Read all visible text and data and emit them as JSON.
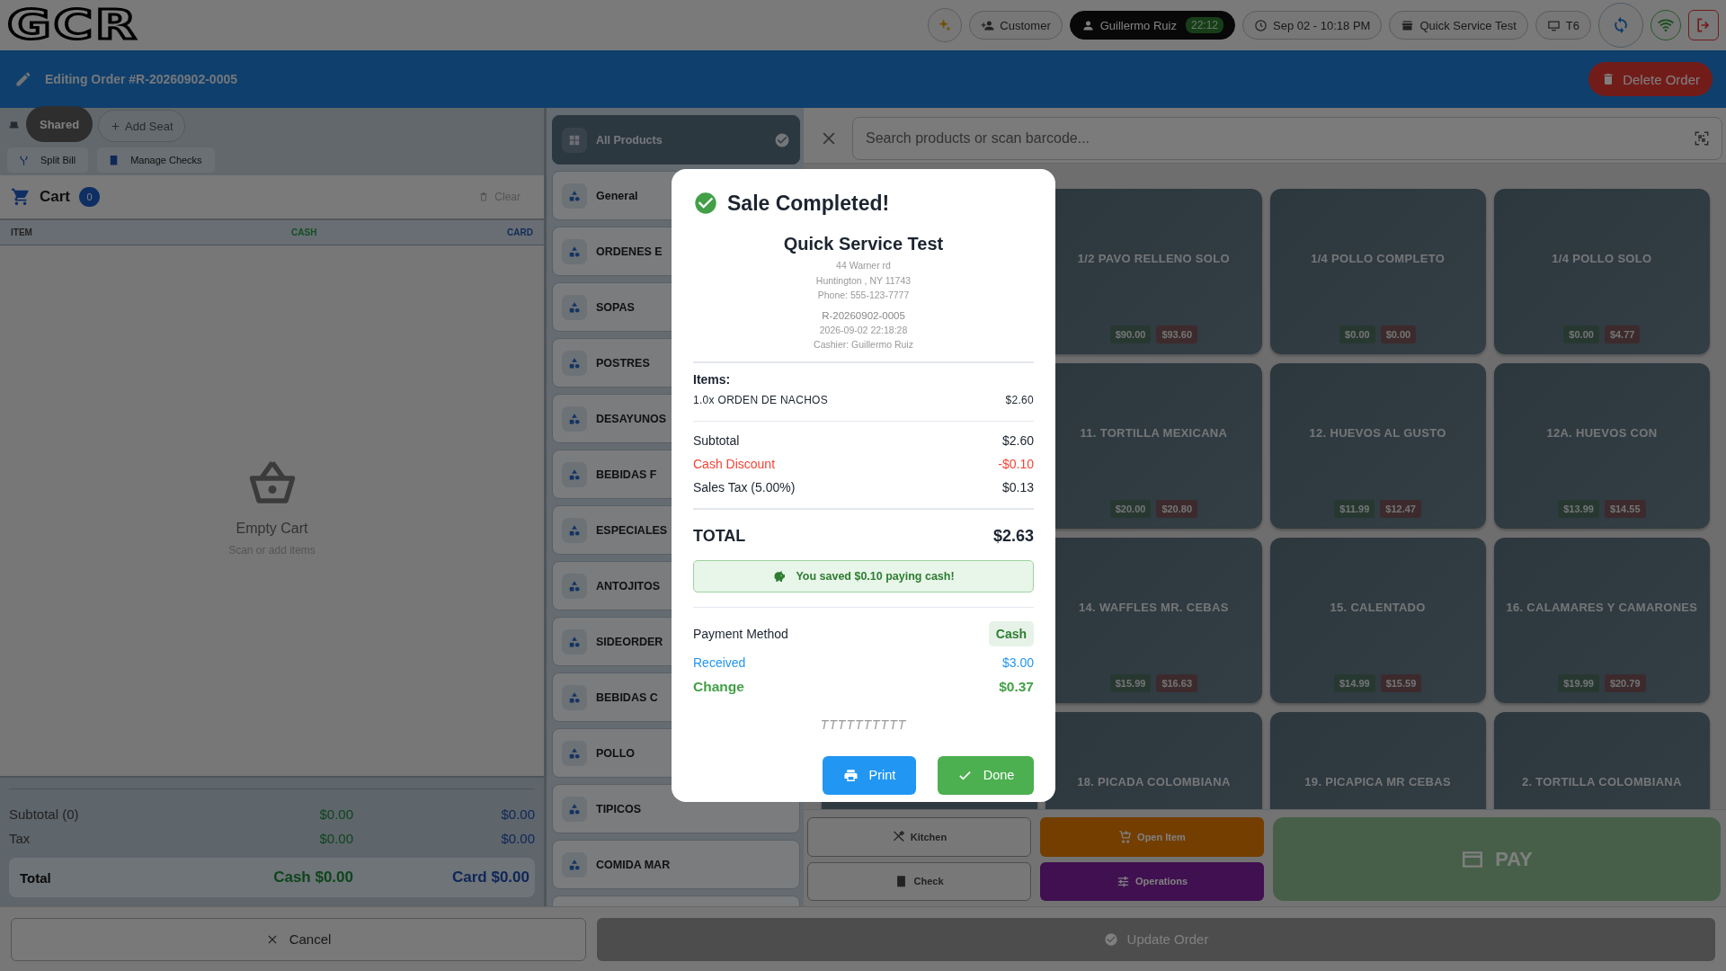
{
  "logo": "GCR",
  "top_bar": {
    "customer_button": "Customer",
    "user": {
      "name": "Guillermo Ruiz",
      "time": "22:12"
    },
    "datetime": "Sep 02 - 10:18 PM",
    "store": "Quick Service Test",
    "terminal": "T6"
  },
  "order_header": {
    "title": "Editing Order #R-20260902-0005",
    "delete_button": "Delete Order"
  },
  "seats": [
    {
      "label": "Shared",
      "selected": true
    }
  ],
  "add_seat": "Add Seat",
  "check_actions": [
    {
      "label": "Split Bill",
      "kind": "split"
    },
    {
      "label": "Manage Checks",
      "kind": "checks"
    }
  ],
  "cart": {
    "title": "Cart",
    "count": "0",
    "clear": "Clear",
    "columns": [
      "ITEM",
      "CASH",
      "CARD"
    ],
    "empty_title": "Empty Cart",
    "empty_hint": "Scan or add items"
  },
  "totals": {
    "rows": [
      {
        "label": "Subtotal (0)",
        "cash": "$0.00",
        "card": "$0.00"
      },
      {
        "label": "Tax",
        "cash": "$0.00",
        "card": "$0.00"
      }
    ],
    "total": {
      "label": "Total",
      "cash": "Cash $0.00",
      "card": "Card $0.00"
    }
  },
  "categories": [
    {
      "label": "All Products",
      "selected": true
    },
    {
      "label": "General",
      "selected": false
    },
    {
      "label": "ORDENES E",
      "selected": false
    },
    {
      "label": "SOPAS",
      "selected": false
    },
    {
      "label": "POSTRES",
      "selected": false
    },
    {
      "label": "DESAYUNOS",
      "selected": false
    },
    {
      "label": "BEBIDAS F",
      "selected": false
    },
    {
      "label": "ESPECIALES",
      "selected": false
    },
    {
      "label": "ANTOJITOS",
      "selected": false
    },
    {
      "label": "SIDEORDER",
      "selected": false
    },
    {
      "label": "BEBIDAS C",
      "selected": false
    },
    {
      "label": "POLLO",
      "selected": false
    },
    {
      "label": "TIPICOS",
      "selected": false
    },
    {
      "label": "COMIDA MAR",
      "selected": false
    }
  ],
  "search": {
    "placeholder": "Search products or scan barcode..."
  },
  "products": [
    {
      "name": "1/2 PAVO RELLENO SOLO",
      "cash": "$90.00",
      "card": "$93.60"
    },
    {
      "name": "1/4 POLLO COMPLETO",
      "cash": "$0.00",
      "card": "$0.00"
    },
    {
      "name": "1/4 POLLO SOLO",
      "cash": "$0.00",
      "card": "$4.77"
    },
    {
      "name": "11. TORTILLA MEXICANA",
      "cash": "$20.00",
      "card": "$20.80"
    },
    {
      "name": "12. HUEVOS AL GUSTO",
      "cash": "$11.99",
      "card": "$12.47"
    },
    {
      "name": "12A. HUEVOS CON",
      "cash": "$13.99",
      "card": "$14.55"
    },
    {
      "name": "14. WAFFLES  MR. CEBAS",
      "cash": "$15.99",
      "card": "$16.63"
    },
    {
      "name": "15. CALENTADO",
      "cash": "$14.99",
      "card": "$15.59"
    },
    {
      "name": "16. CALAMARES Y CAMARONES",
      "cash": "$19.99",
      "card": "$20.79"
    },
    {
      "name": "18. PICADA COLOMBIANA"
    },
    {
      "name": "19. PICAPICA MR CEBAS"
    },
    {
      "name": "2. TORTILLA COLOMBIANA"
    }
  ],
  "actions": [
    {
      "label": "Kitchen",
      "kind": "kitchen"
    },
    {
      "label": "Open Item",
      "kind": "open"
    },
    {
      "label": "Check",
      "kind": "check"
    },
    {
      "label": "Operations",
      "kind": "operations"
    }
  ],
  "pay_button": {
    "label": "PAY",
    "disabled": true
  },
  "bottom_bar": {
    "cancel": "Cancel",
    "update": {
      "label": "Update Order",
      "disabled": true
    }
  },
  "modal": {
    "title": "Sale Completed!",
    "store_name": "Quick Service Test",
    "address": [
      "44 Warner rd",
      "Huntington , NY 11743",
      "Phone: 555-123-7777"
    ],
    "receipt_number": "R-20260902-0005",
    "receipt_datetime": "2026-09-02 22:18:28",
    "cashier": "Cashier: Guillermo Ruiz",
    "items_label": "Items:",
    "items": [
      {
        "text": "1.0x ORDEN DE NACHOS",
        "price": "$2.60"
      }
    ],
    "lines": [
      {
        "label": "Subtotal",
        "value": "$2.60",
        "kind": "normal"
      },
      {
        "label": "Cash Discount",
        "value": "-$0.10",
        "kind": "discount"
      },
      {
        "label": "Sales Tax (5.00%)",
        "value": "$0.13",
        "kind": "normal"
      }
    ],
    "total": {
      "label": "TOTAL",
      "value": "$2.63"
    },
    "savings": "You saved $0.10 paying cash!",
    "payment": {
      "label": "Payment Method",
      "method": "Cash"
    },
    "received": {
      "label": "Received",
      "value": "$3.00"
    },
    "change": {
      "label": "Change",
      "value": "$0.37"
    },
    "signature": "TTTTTTTTTT",
    "buttons": [
      {
        "label": "Print",
        "kind": "print"
      },
      {
        "label": "Done",
        "kind": "done"
      }
    ]
  }
}
